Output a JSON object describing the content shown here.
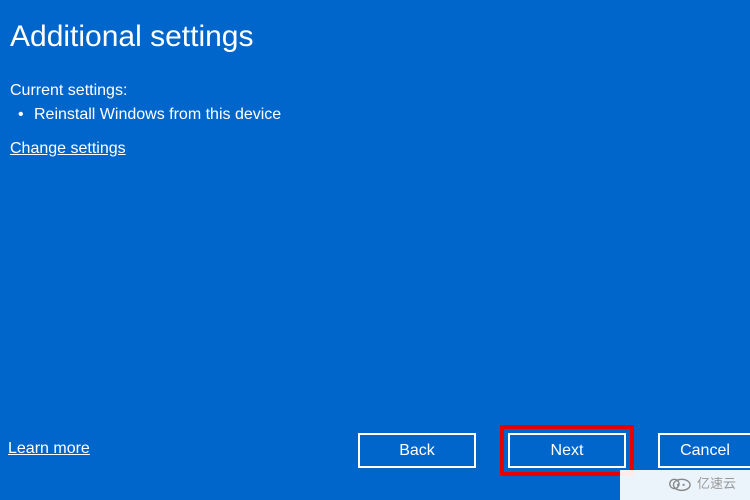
{
  "title": "Additional settings",
  "subheading": "Current settings:",
  "settings_list": [
    "Reinstall Windows from this device"
  ],
  "links": {
    "change_settings": "Change settings",
    "learn_more": "Learn more"
  },
  "buttons": {
    "back": "Back",
    "next": "Next",
    "cancel": "Cancel"
  },
  "watermark": {
    "text": "亿速云"
  },
  "colors": {
    "background": "#0066CC",
    "highlight": "#E60000"
  }
}
